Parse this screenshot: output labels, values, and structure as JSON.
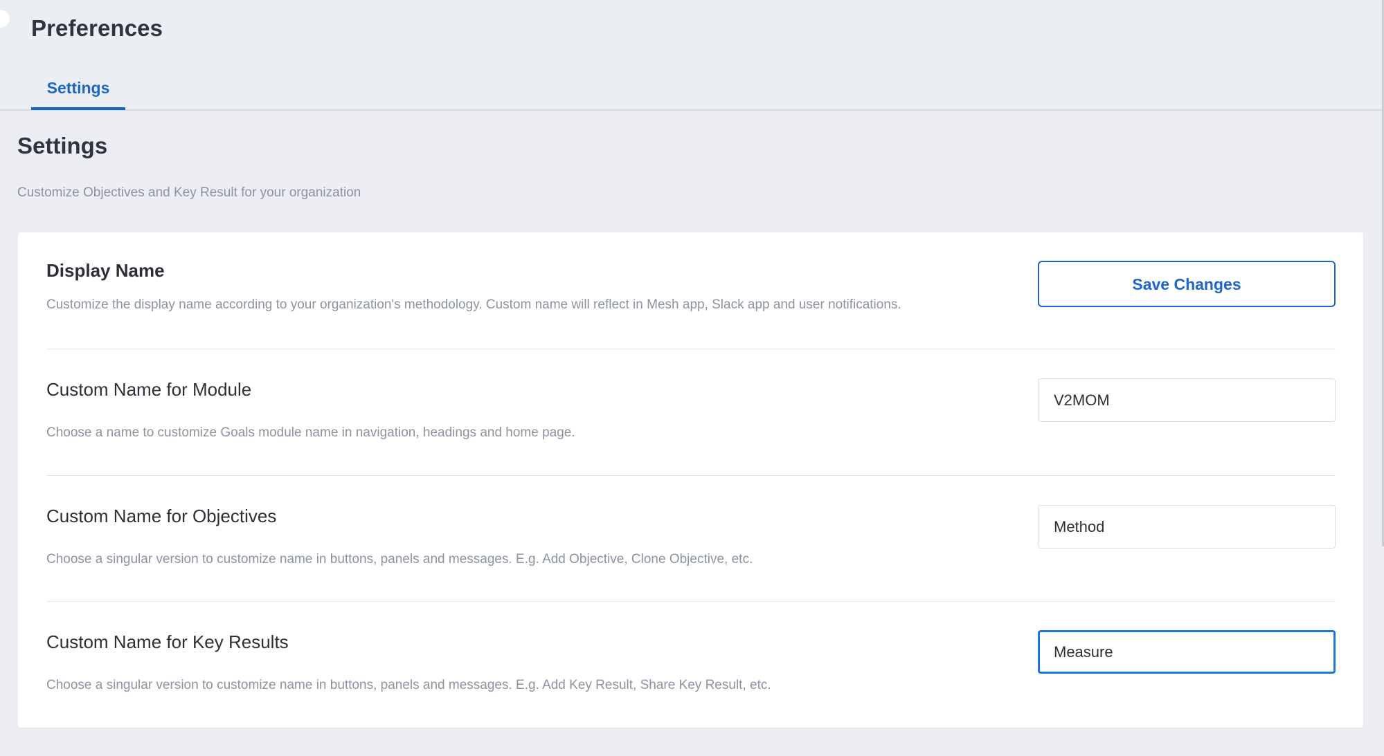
{
  "header": {
    "title": "Preferences",
    "tabs": [
      {
        "label": "Settings",
        "active": true
      }
    ]
  },
  "section": {
    "title": "Settings",
    "subtitle": "Customize Objectives and Key Result for your organization"
  },
  "card": {
    "display_name": {
      "title": "Display Name",
      "description": "Customize the display name according to your organization's methodology. Custom name will reflect in Mesh app, Slack app and user notifications.",
      "save_label": "Save Changes"
    },
    "module": {
      "title": "Custom Name for Module",
      "description": "Choose a name to customize Goals module name in navigation, headings and home page.",
      "value": "V2MOM"
    },
    "objectives": {
      "title": "Custom Name for Objectives",
      "description": "Choose a singular version to customize name in buttons, panels and messages. E.g. Add Objective, Clone Objective, etc.",
      "value": "Method"
    },
    "key_results": {
      "title": "Custom Name for Key Results",
      "description": "Choose a singular version to customize name in buttons, panels and messages. E.g. Add Key Result, Share Key Result, etc.",
      "value": "Measure"
    }
  },
  "colors": {
    "accent": "#1b66c9",
    "background": "#eceef3",
    "card": "#ffffff",
    "muted_text": "#8c93a0"
  }
}
